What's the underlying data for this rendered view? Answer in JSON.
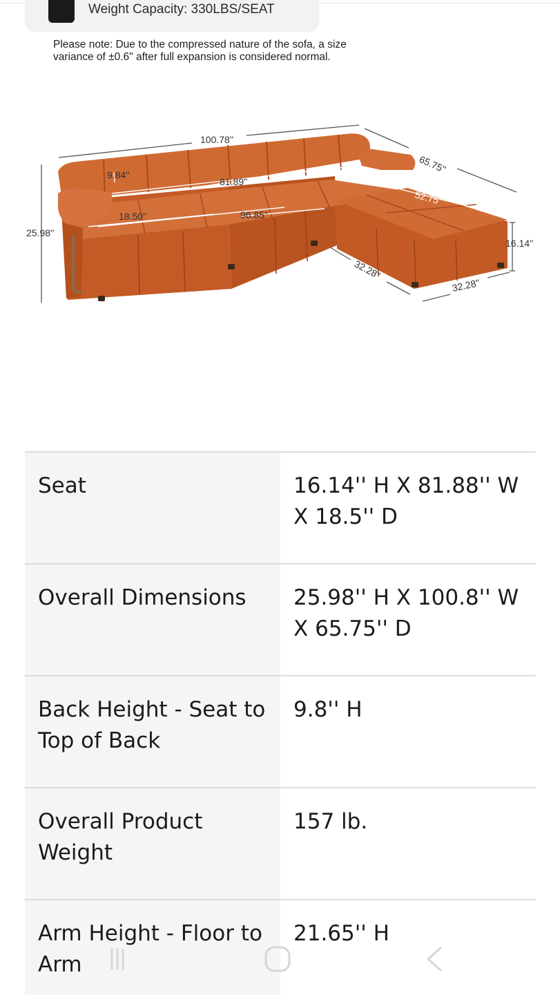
{
  "capacity": {
    "text": "Weight Capacity: 330LBS/SEAT"
  },
  "note": {
    "line1": "Please note: Due to the compressed nature of the sofa, a size",
    "line2": "variance of ±0.6\" after full expansion is considered normal."
  },
  "diagram": {
    "overall_width": "100.78''",
    "overall_depth": "65.75''",
    "back_height": "9.84''",
    "seat_width": "81.89''",
    "chaise_width": "52.75''",
    "seat_depth": "18.50''",
    "total_seat_width": "96.85''",
    "overall_height": "25.98''",
    "seat_height": "16.14''",
    "ottoman_depth": "32.28''",
    "ottoman_width": "32.28''",
    "colors": {
      "upholstery": "#c9602a",
      "upholstery_dark": "#a84a1c",
      "upholstery_light": "#d9733a",
      "frame_leg": "#8c6a4a"
    }
  },
  "specs": [
    {
      "label": "Seat",
      "value": "16.14'' H X 81.88'' W X 18.5'' D"
    },
    {
      "label": "Overall Dimensions",
      "value": "25.98'' H X 100.8'' W X 65.75'' D"
    },
    {
      "label": "Back Height - Seat to Top of Back",
      "value": "9.8'' H"
    },
    {
      "label": "Overall Product Weight",
      "value": "157 lb."
    },
    {
      "label": "Arm Height - Floor to Arm",
      "value": "21.65'' H"
    }
  ],
  "nav": {
    "recent_icon": "recent-apps-icon",
    "home_icon": "home-icon",
    "back_icon": "back-icon"
  }
}
